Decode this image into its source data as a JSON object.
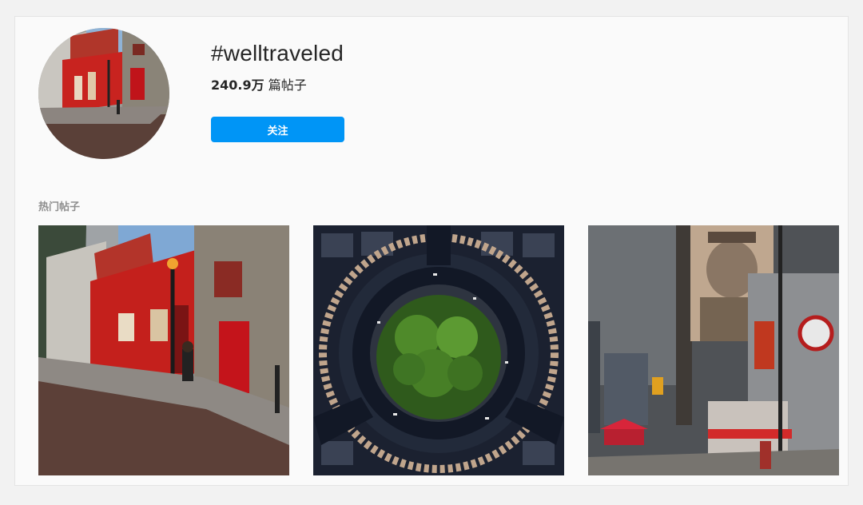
{
  "header": {
    "hashtag": "#welltraveled",
    "post_count_value": "240.9万",
    "post_count_unit": "篇帖子",
    "follow_label": "关注"
  },
  "top_posts": {
    "title": "热门帖子",
    "items": [
      {
        "icon": "street-red-building-photo"
      },
      {
        "icon": "roundabout-aerial-photo"
      },
      {
        "icon": "city-street-mural-photo"
      }
    ]
  },
  "colors": {
    "accent": "#0095f6",
    "background": "#fafafa",
    "text": "#262626",
    "muted": "#8e8e8e"
  }
}
